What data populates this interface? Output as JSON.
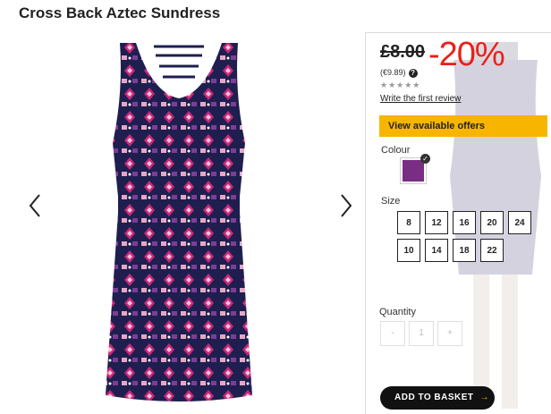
{
  "product": {
    "title": "Cross Back Aztec Sundress"
  },
  "pricing": {
    "price": "£8.00",
    "discount": "-20%",
    "alt_price": "(€9.89)",
    "help_glyph": "?",
    "rating_stars": "★★★★★",
    "review_link": "Write the first review"
  },
  "offers": {
    "label": "View available offers",
    "color": "#f7b500"
  },
  "colour": {
    "label": "Colour",
    "selected_color": "#7a2d84",
    "check_glyph": "✓"
  },
  "size": {
    "label": "Size",
    "options": [
      "8",
      "12",
      "16",
      "20",
      "24",
      "10",
      "14",
      "18",
      "22"
    ]
  },
  "quantity": {
    "label": "Quantity",
    "minus": "-",
    "value": "1",
    "plus": "+"
  },
  "basket": {
    "label": "ADD TO BASKET",
    "arrow": "→"
  },
  "carousel": {
    "prev_icon": "chevron-left-icon",
    "next_icon": "chevron-right-icon"
  }
}
